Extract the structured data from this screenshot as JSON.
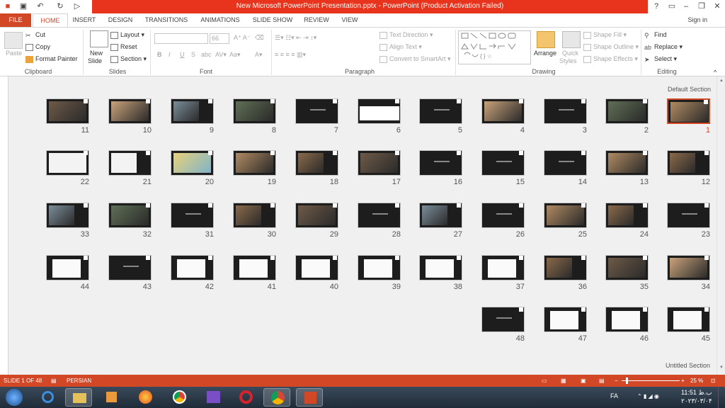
{
  "window": {
    "title": "New Microsoft PowerPoint Presentation.pptx -  PowerPoint (Product Activation Failed)",
    "help": "?",
    "signin": "Sign in"
  },
  "tabs": [
    "FILE",
    "HOME",
    "INSERT",
    "DESIGN",
    "TRANSITIONS",
    "ANIMATIONS",
    "SLIDE SHOW",
    "REVIEW",
    "VIEW"
  ],
  "ribbon": {
    "clipboard": {
      "paste": "Paste",
      "cut": "Cut",
      "copy": "Copy",
      "format_painter": "Format Painter",
      "label": "Clipboard"
    },
    "slides": {
      "new_slide_1": "New",
      "new_slide_2": "Slide",
      "layout": "Layout",
      "reset": "Reset",
      "section": "Section",
      "label": "Slides"
    },
    "font": {
      "size": "66",
      "label": "Font"
    },
    "paragraph": {
      "text_direction": "Text Direction",
      "align_text": "Align Text",
      "convert": "Convert to SmartArt",
      "label": "Paragraph"
    },
    "drawing": {
      "arrange": "Arrange",
      "quick_1": "Quick",
      "quick_2": "Styles",
      "shape_fill": "Shape Fill",
      "shape_outline": "Shape Outline",
      "shape_effects": "Shape Effects",
      "label": "Drawing"
    },
    "editing": {
      "find": "Find",
      "replace": "Replace",
      "select": "Select",
      "label": "Editing"
    }
  },
  "sections": {
    "default": "Default Section",
    "untitled": "Untitled Section"
  },
  "slides": {
    "row1": [
      "11",
      "10",
      "9",
      "8",
      "7",
      "6",
      "5",
      "4",
      "3",
      "2",
      "1"
    ],
    "row2": [
      "22",
      "21",
      "20",
      "19",
      "18",
      "17",
      "16",
      "15",
      "14",
      "13",
      "12"
    ],
    "row3": [
      "33",
      "32",
      "31",
      "30",
      "29",
      "28",
      "27",
      "26",
      "25",
      "24",
      "23"
    ],
    "row4": [
      "44",
      "43",
      "42",
      "41",
      "40",
      "39",
      "38",
      "37",
      "36",
      "35",
      "34"
    ],
    "row5": [
      "48",
      "47",
      "46",
      "45"
    ]
  },
  "status": {
    "slide": "SLIDE 1 OF 48",
    "language": "PERSIAN",
    "zoom": "25 %"
  },
  "taskbar": {
    "lang": "FA",
    "time": "11:51 ب.ظ",
    "date": "۲۰۲۳/۰۳/۰۴"
  },
  "colors": {
    "accent": "#d24726",
    "title_bar": "#e8341c"
  }
}
